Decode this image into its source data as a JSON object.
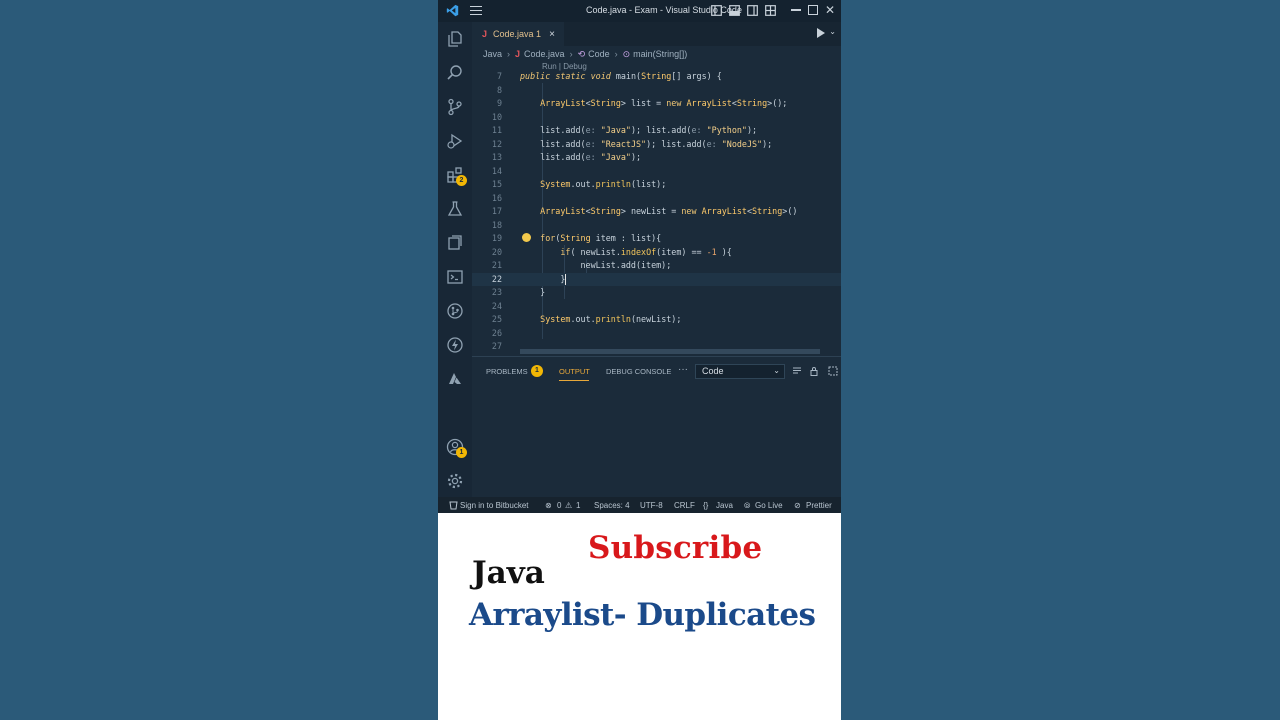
{
  "window": {
    "title": "Code.java - Exam - Visual Studio Code"
  },
  "activity_bar": {
    "extensions_badge": "2",
    "accounts_badge": "1"
  },
  "tab": {
    "icon": "J",
    "label": "Code.java 1",
    "close": "×"
  },
  "breadcrumb": {
    "root": "Java",
    "file_icon": "J",
    "file": "Code.java",
    "class_icon": "⟲",
    "class": "Code",
    "method_icon": "⊙",
    "method": "main(String[])"
  },
  "editor": {
    "codelens": "Run | Debug",
    "lines": [
      {
        "n": "7",
        "text": "public static void main(String[] args) {"
      },
      {
        "n": "8",
        "text": ""
      },
      {
        "n": "9",
        "text": "    ArrayList<String> list = new ArrayList<String>();"
      },
      {
        "n": "10",
        "text": ""
      },
      {
        "n": "11",
        "text": "    list.add(e: \"Java\"); list.add(e: \"Python\");"
      },
      {
        "n": "12",
        "text": "    list.add(e: \"ReactJS\"); list.add(e: \"NodeJS\");"
      },
      {
        "n": "13",
        "text": "    list.add(e: \"Java\");"
      },
      {
        "n": "14",
        "text": ""
      },
      {
        "n": "15",
        "text": "    System.out.println(list);"
      },
      {
        "n": "16",
        "text": ""
      },
      {
        "n": "17",
        "text": "    ArrayList<String> newList = new ArrayList<String>()"
      },
      {
        "n": "18",
        "text": ""
      },
      {
        "n": "19",
        "text": "    for(String item : list){"
      },
      {
        "n": "20",
        "text": "        if( newList.indexOf(item) == -1 ){"
      },
      {
        "n": "21",
        "text": "            newList.add(item);"
      },
      {
        "n": "22",
        "text": "        }"
      },
      {
        "n": "23",
        "text": "    }"
      },
      {
        "n": "24",
        "text": ""
      },
      {
        "n": "25",
        "text": "    System.out.println(newList);"
      },
      {
        "n": "26",
        "text": ""
      },
      {
        "n": "27",
        "text": ""
      }
    ]
  },
  "panel": {
    "tabs": {
      "problems": "PROBLEMS",
      "problems_badge": "1",
      "output": "OUTPUT",
      "debug_console": "DEBUG CONSOLE",
      "more": "···"
    },
    "output_channel": "Code"
  },
  "status_bar": {
    "bitbucket": "Sign in to Bitbucket",
    "errors": "0",
    "warnings": "1",
    "spaces": "Spaces: 4",
    "encoding": "UTF-8",
    "eol": "CRLF",
    "language": "Java",
    "language_icon": "{}",
    "go_live": "Go Live",
    "prettier": "Prettier"
  },
  "caption": {
    "subscribe": "Subscribe",
    "line1": "Java",
    "line2": "Arraylist- Duplicates"
  },
  "colors": {
    "background": "#2b5a79",
    "editor_bg": "#1b2b3a",
    "accent_orange": "#e8a83a",
    "badge_yellow": "#f2b705",
    "subscribe_red": "#d8181b",
    "title_blue": "#1b4a8a"
  }
}
